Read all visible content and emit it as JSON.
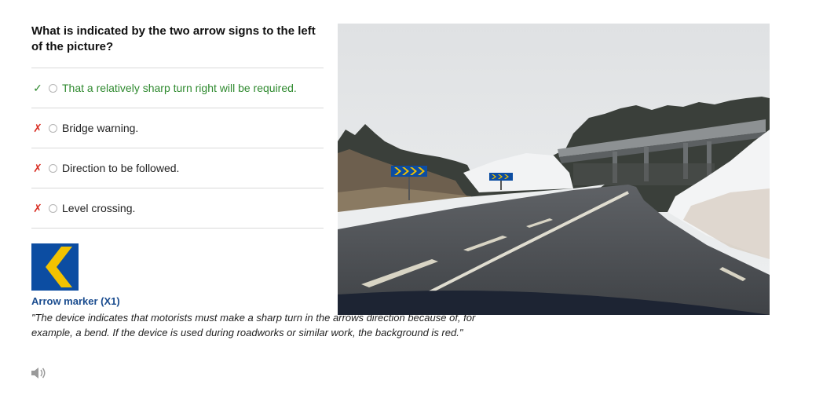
{
  "question": "What is indicated by the two arrow signs to the left of the picture?",
  "answers": [
    {
      "mark": "✓",
      "label": "That a relatively sharp turn right will be required."
    },
    {
      "mark": "✗",
      "label": "Bridge warning."
    },
    {
      "mark": "✗",
      "label": "Direction to be followed."
    },
    {
      "mark": "✗",
      "label": "Level crossing."
    }
  ],
  "sign": {
    "title": "Arrow marker (X1)",
    "description": "\"The device indicates that motorists must make a sharp turn in the arrows direction because of, for example, a bend. If the device is used during roadworks or similar work, the background is red.\""
  },
  "icons": {
    "correct": "check-icon",
    "incorrect": "cross-icon",
    "audio": "speaker-icon"
  },
  "colors": {
    "correct": "#2f8a2f",
    "incorrect": "#d93025",
    "sign_blue": "#0c4da2",
    "sign_yellow": "#f2c200",
    "title_blue": "#1a4c8f"
  }
}
